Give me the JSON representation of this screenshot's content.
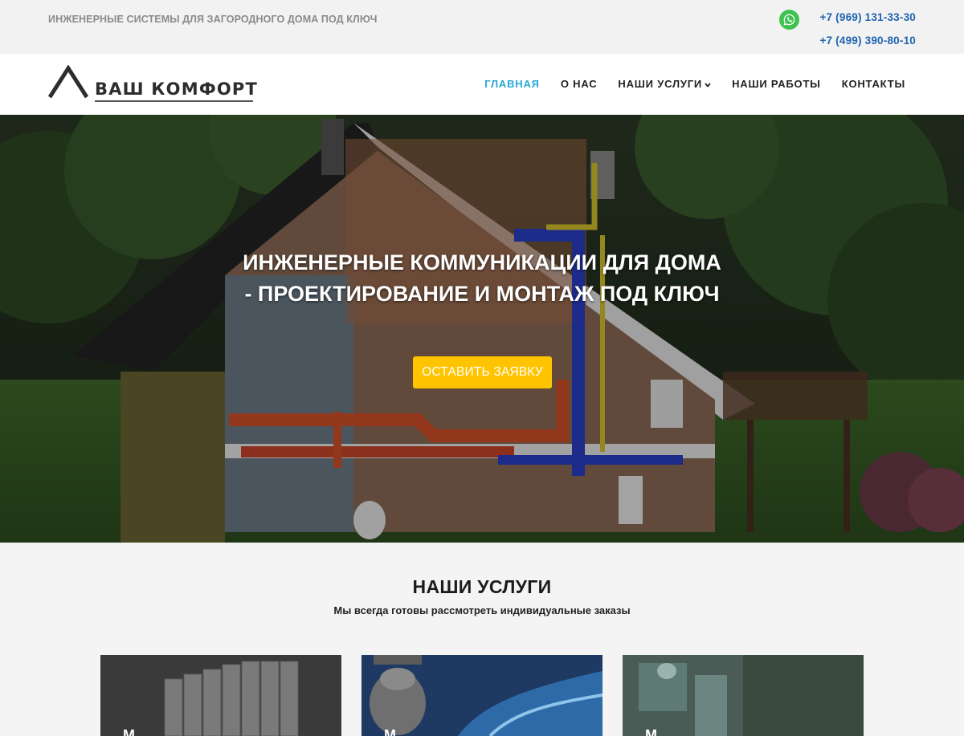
{
  "topbar": {
    "tagline": "ИНЖЕНЕРНЫЕ СИСТЕМЫ ДЛЯ ЗАГОРОДНОГО ДОМА ПОД КЛЮЧ",
    "phones": [
      "+7 (969) 131-33-30",
      "+7 (499) 390-80-10"
    ],
    "whatsapp_icon": "whatsapp-icon"
  },
  "header": {
    "logo_text": "ВАШ КОМФОРТ",
    "nav": [
      {
        "label": "ГЛАВНАЯ",
        "active": true
      },
      {
        "label": "О НАС",
        "active": false
      },
      {
        "label": "НАШИ УСЛУГИ",
        "active": false,
        "has_dropdown": true
      },
      {
        "label": "НАШИ РАБОТЫ",
        "active": false
      },
      {
        "label": "КОНТАКТЫ",
        "active": false
      }
    ],
    "dropdown_icon": "chevron-down-icon"
  },
  "hero": {
    "title": "ИНЖЕНЕРНЫЕ КОММУНИКАЦИИ ДЛЯ ДОМА - ПРОЕКТИРОВАНИЕ И МОНТАЖ ПОД КЛЮЧ",
    "cta_label": "ОСТАВИТЬ ЗАЯВКУ"
  },
  "services": {
    "heading": "НАШИ УСЛУГИ",
    "subheading": "Мы всегда готовы рассмотреть индивидуальные заказы",
    "cards": [
      {
        "title_visible": "М"
      },
      {
        "title_visible": "М"
      },
      {
        "title_visible": "М"
      }
    ]
  },
  "colors": {
    "accent": "#29a9d8",
    "cta": "#ffc400",
    "phone": "#1e63b0",
    "whatsapp": "#3fc250"
  }
}
